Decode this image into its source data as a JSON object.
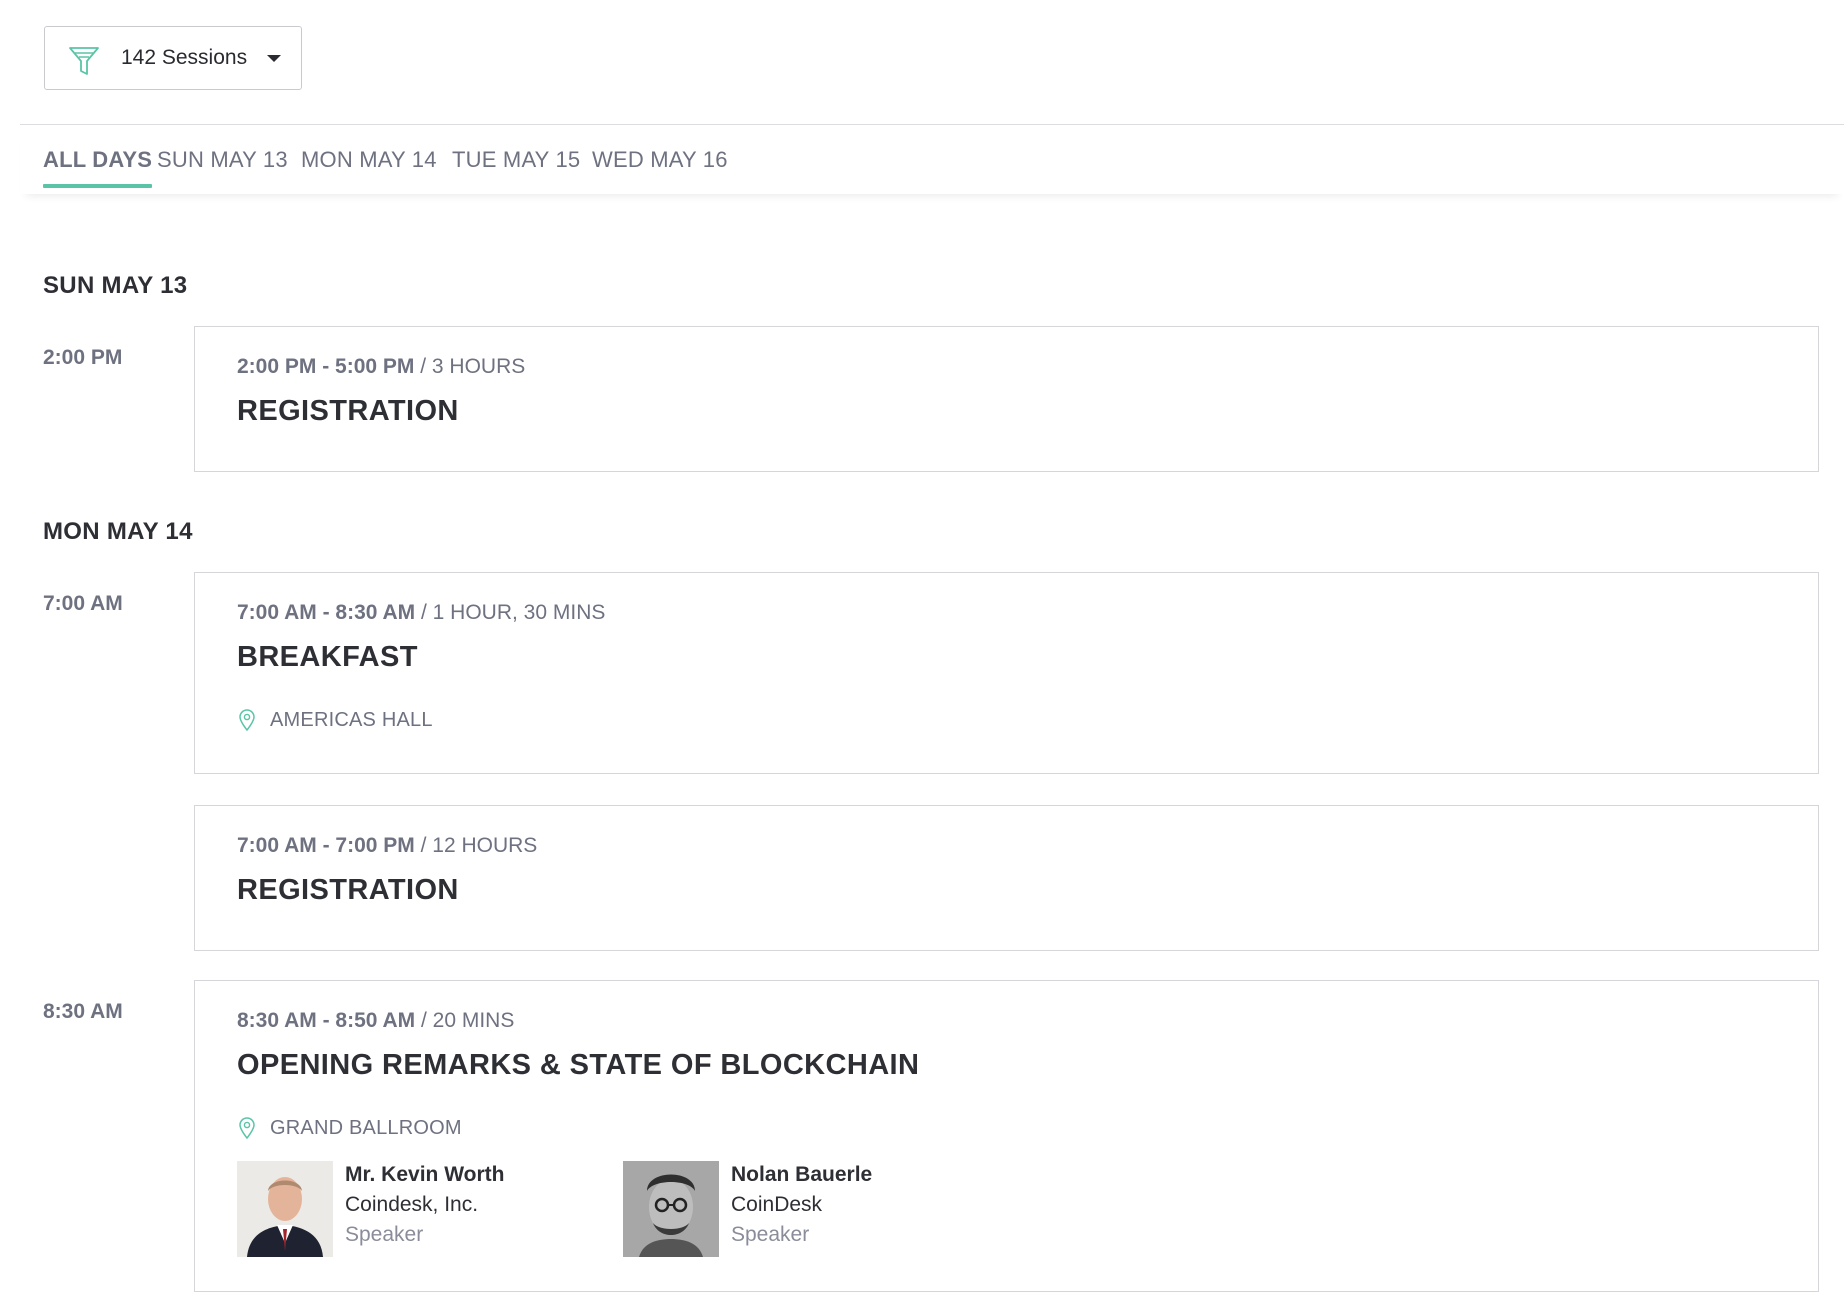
{
  "filter": {
    "count_label": "142 Sessions",
    "icon": "funnel-icon",
    "accent_color": "#5ac4a6"
  },
  "tabs": [
    {
      "label": "ALL DAYS",
      "active": true
    },
    {
      "label": "SUN MAY 13",
      "active": false
    },
    {
      "label": "MON MAY 14",
      "active": false
    },
    {
      "label": "TUE MAY 15",
      "active": false
    },
    {
      "label": "WED MAY 16",
      "active": false
    }
  ],
  "days": [
    {
      "heading": "SUN MAY 13",
      "slots": [
        {
          "time": "2:00 PM",
          "sessions": [
            {
              "range": "2:00 PM - 5:00 PM",
              "duration": " / 3 HOURS",
              "title": "REGISTRATION"
            }
          ]
        }
      ]
    },
    {
      "heading": "MON MAY 14",
      "slots": [
        {
          "time": "7:00 AM",
          "sessions": [
            {
              "range": "7:00 AM - 8:30 AM",
              "duration": " / 1 HOUR, 30 MINS",
              "title": "BREAKFAST",
              "location": "AMERICAS HALL"
            },
            {
              "range": "7:00 AM - 7:00 PM",
              "duration": " / 12 HOURS",
              "title": "REGISTRATION"
            }
          ]
        },
        {
          "time": "8:30 AM",
          "sessions": [
            {
              "range": "8:30 AM - 8:50 AM",
              "duration": " / 20 MINS",
              "title": "OPENING REMARKS & STATE OF BLOCKCHAIN",
              "location": "GRAND BALLROOM",
              "speakers": [
                {
                  "name": "Mr. Kevin Worth",
                  "org": "Coindesk, Inc.",
                  "role": "Speaker"
                },
                {
                  "name": "Nolan Bauerle",
                  "org": "CoinDesk",
                  "role": "Speaker"
                }
              ]
            }
          ]
        }
      ]
    }
  ]
}
